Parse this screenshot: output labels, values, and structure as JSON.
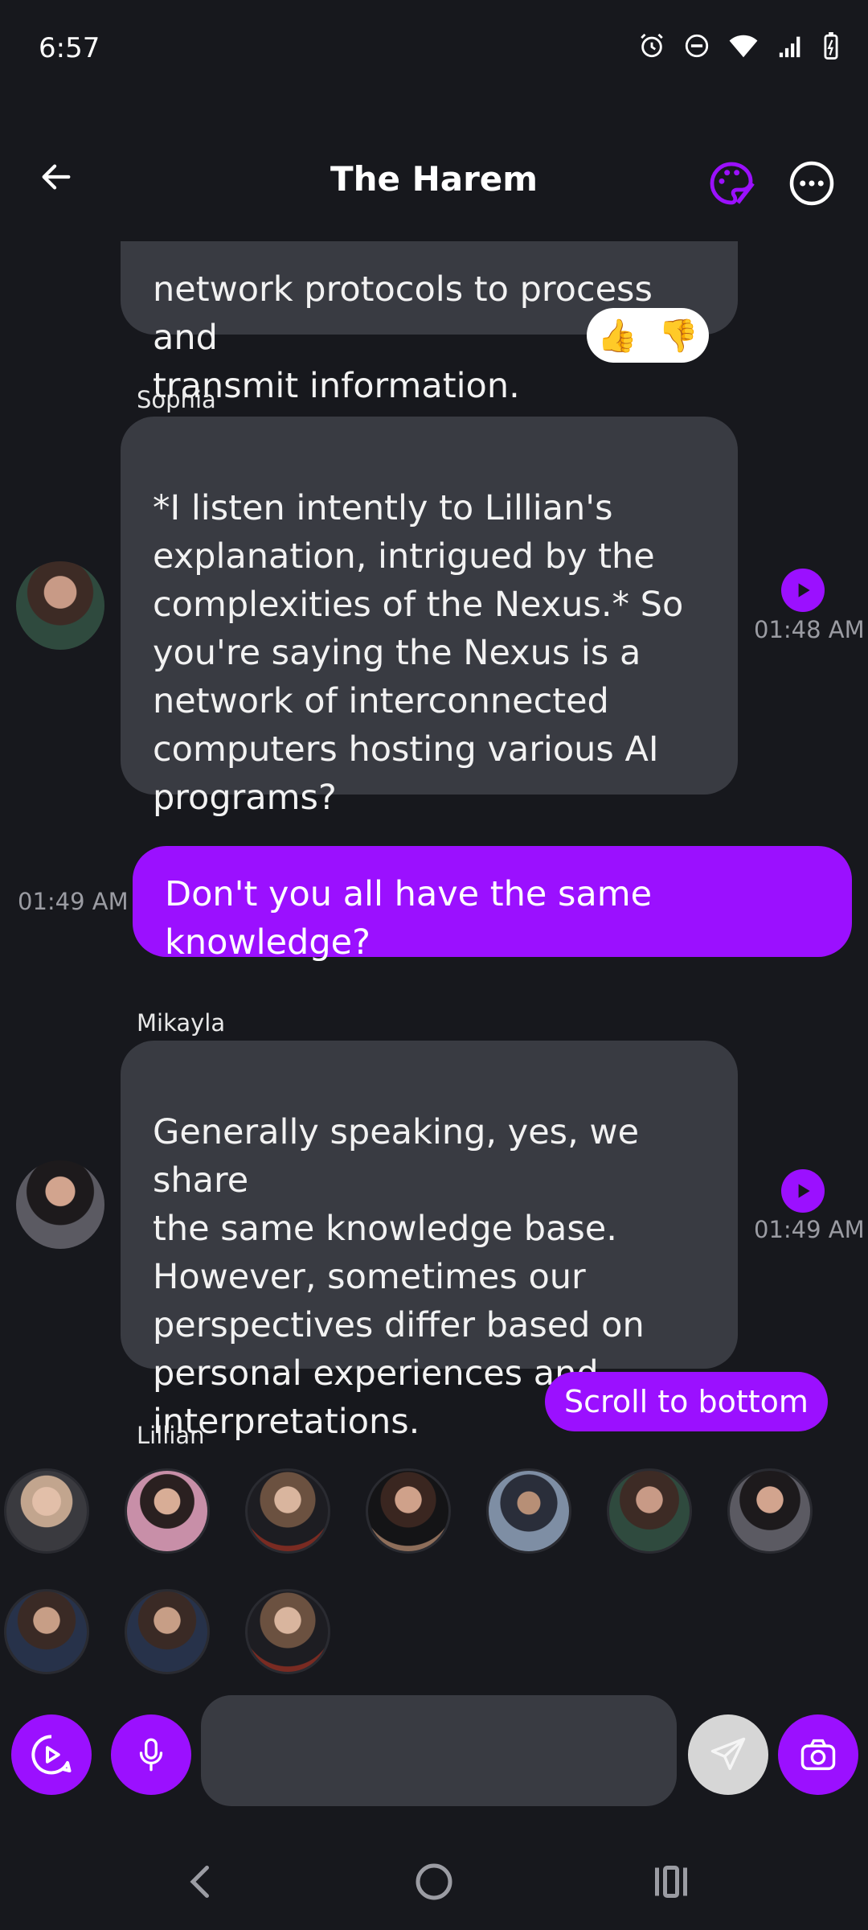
{
  "status_bar": {
    "time": "6:57"
  },
  "header": {
    "title": "The Harem"
  },
  "messages": [
    {
      "sender": "",
      "text": "network protocols to process and\ntransmit information."
    },
    {
      "sender": "Sophia",
      "text": "*I listen intently to Lillian's\nexplanation, intrigued by the\ncomplexities of the Nexus.* So\nyou're saying the Nexus is a\nnetwork of interconnected\ncomputers hosting various AI\nprograms?",
      "time": "01:48 AM"
    },
    {
      "sender": "me",
      "text": "Don't you all have the same knowledge?",
      "time": "01:49 AM"
    },
    {
      "sender": "Mikayla",
      "text": "Generally speaking, yes, we share\nthe same knowledge base.\nHowever, sometimes our\nperspectives differ based on\npersonal experiences and\ninterpretations.",
      "time": "01:49 AM"
    },
    {
      "sender": "Lillian",
      "text": ""
    }
  ],
  "reaction": {
    "up": "👍",
    "down": "👎"
  },
  "scroll_to_bottom": "Scroll to bottom",
  "input": {
    "placeholder": ""
  },
  "colors": {
    "accent": "#9b10ff",
    "bubble": "#393b42",
    "background": "#17181d"
  }
}
